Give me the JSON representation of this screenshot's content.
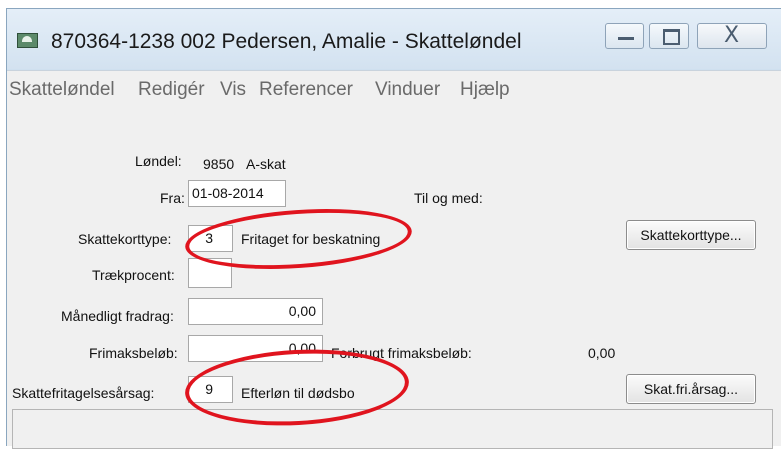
{
  "window": {
    "title": "870364-1238 002 Pedersen, Amalie - Skatteløndel",
    "app_icon": "app-icon",
    "controls": {
      "minimize_icon": "minimize-icon",
      "maximize_icon": "maximize-icon",
      "close_icon": "close-icon",
      "close_glyph": "X"
    }
  },
  "menu": {
    "items": [
      {
        "label": "Skatteløndel"
      },
      {
        "label": "Redigér"
      },
      {
        "label": "Vis"
      },
      {
        "label": "Referencer"
      },
      {
        "label": "Vinduer"
      },
      {
        "label": "Hjælp"
      }
    ]
  },
  "form": {
    "londel_label": "Løndel:",
    "londel_number": "9850",
    "londel_name": "A-skat",
    "fra_label": "Fra:",
    "fra_value": "01-08-2014",
    "til_label": "Til og med:",
    "skattekorttype_label": "Skattekorttype:",
    "skattekorttype_value": "3",
    "skattekorttype_desc": "Fritaget for beskatning",
    "skattekorttype_button": "Skattekorttype...",
    "traekprocent_label": "Trækprocent:",
    "traekprocent_value": "",
    "maanedligt_label": "Månedligt fradrag:",
    "maanedligt_value": "0,00",
    "frimaks_label": "Frimaksbeløb:",
    "frimaks_value": "0,00",
    "forbrugt_label": "Forbrugt frimaksbeløb:",
    "forbrugt_value": "0,00",
    "skattefri_label": "Skattefritagelsesårsag:",
    "skattefri_value": "9",
    "skattefri_desc": "Efterløn til dødsbo",
    "skattefri_button": "Skat.fri.årsag..."
  },
  "annotations": {
    "color": "#e0141e"
  }
}
